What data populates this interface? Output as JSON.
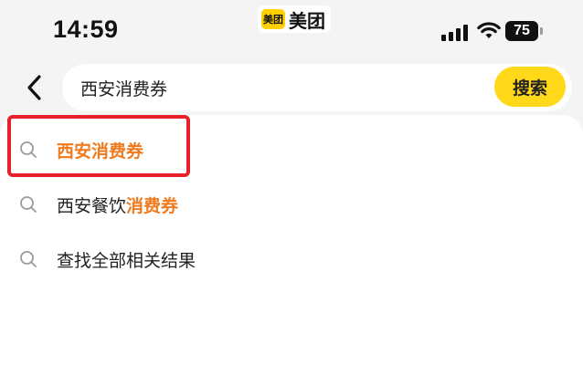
{
  "status_bar": {
    "time": "14:59",
    "app_logo_text": "美团",
    "app_name": "美团",
    "battery_level": "75"
  },
  "search": {
    "value": "西安消费券",
    "button_label": "搜索"
  },
  "suggestions": [
    {
      "prefix": "",
      "highlight": "西安消费券",
      "suffix": ""
    },
    {
      "prefix": "西安餐饮",
      "highlight": "消费券",
      "suffix": ""
    },
    {
      "prefix": "查找全部相关结果",
      "highlight": "",
      "suffix": ""
    }
  ],
  "colors": {
    "accent": "#ffd81a",
    "highlight_text": "#f07a1e",
    "annotation": "#e8202a"
  },
  "icons": {
    "back": "chevron-left-icon",
    "suggestion": "search-icon"
  }
}
